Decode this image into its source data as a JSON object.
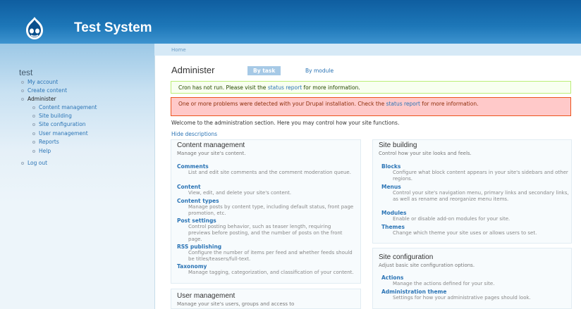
{
  "site": {
    "name": "Test System"
  },
  "sidebar": {
    "user": "test",
    "items": [
      {
        "label": "My account"
      },
      {
        "label": "Create content"
      },
      {
        "label": "Administer"
      },
      {
        "label": "Content management"
      },
      {
        "label": "Site building"
      },
      {
        "label": "Site configuration"
      },
      {
        "label": "User management"
      },
      {
        "label": "Reports"
      },
      {
        "label": "Help"
      },
      {
        "label": "Log out"
      }
    ]
  },
  "breadcrumb": "Home",
  "page": {
    "title": "Administer",
    "tabs": [
      {
        "label": "By task"
      },
      {
        "label": "By module"
      }
    ]
  },
  "messages": {
    "status_before": "Cron has not run. Please visit the ",
    "status_link": "status report",
    "status_after": " for more information.",
    "error_before": "One or more problems were detected with your Drupal installation. Check the ",
    "error_link": "status report",
    "error_after": " for more information."
  },
  "welcome": "Welcome to the administration section. Here you may control how your site functions.",
  "hide_descriptions": "Hide descriptions",
  "panels": {
    "content_management": {
      "title": "Content management",
      "desc": "Manage your site's content.",
      "items": [
        {
          "title": "Comments",
          "desc": "List and edit site comments and the comment moderation queue."
        },
        {
          "title": "Content",
          "desc": "View, edit, and delete your site's content."
        },
        {
          "title": "Content types",
          "desc": "Manage posts by content type, including default status, front page promotion, etc."
        },
        {
          "title": "Post settings",
          "desc": "Control posting behavior, such as teaser length, requiring previews before posting, and the number of posts on the front page."
        },
        {
          "title": "RSS publishing",
          "desc": "Configure the number of items per feed and whether feeds should be titles/teasers/full-text."
        },
        {
          "title": "Taxonomy",
          "desc": "Manage tagging, categorization, and classification of your content."
        }
      ]
    },
    "user_management": {
      "title": "User management",
      "desc": "Manage your site's users, groups and access to"
    },
    "site_building": {
      "title": "Site building",
      "desc": "Control how your site looks and feels.",
      "items": [
        {
          "title": "Blocks",
          "desc": "Configure what block content appears in your site's sidebars and other regions."
        },
        {
          "title": "Menus",
          "desc": "Control your site's navigation menu, primary links and secondary links, as well as rename and reorganize menu items."
        },
        {
          "title": "Modules",
          "desc": "Enable or disable add-on modules for your site."
        },
        {
          "title": "Themes",
          "desc": "Change which theme your site uses or allows users to set."
        }
      ]
    },
    "site_configuration": {
      "title": "Site configuration",
      "desc": "Adjust basic site configuration options.",
      "items": [
        {
          "title": "Actions",
          "desc": "Manage the actions defined for your site."
        },
        {
          "title": "Administration theme",
          "desc": "Settings for how your administrative pages should look."
        }
      ]
    }
  }
}
